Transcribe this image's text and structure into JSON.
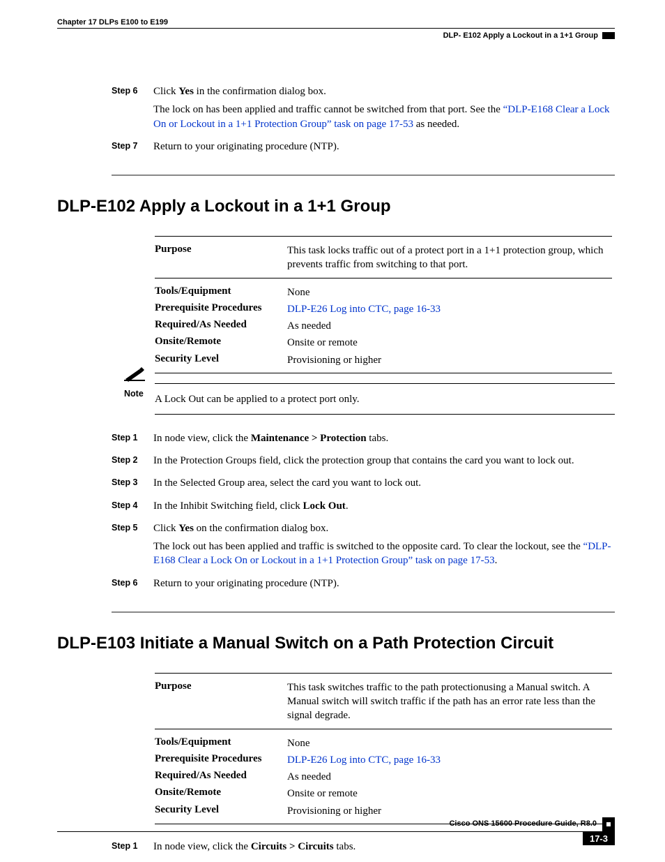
{
  "header": {
    "chapter": "Chapter 17 DLPs E100 to E199",
    "titlebar": "DLP- E102 Apply a Lockout in a 1+1 Group"
  },
  "topsteps": {
    "s6": {
      "label": "Step 6",
      "p1a": "Click ",
      "p1b": "Yes",
      "p1c": " in the confirmation dialog box.",
      "p2a": "The lock on has been applied and traffic cannot be switched from that port. See the ",
      "p2link": "“DLP-E168 Clear a Lock On or Lockout in a 1+1 Protection Group” task on page 17-53",
      "p2b": " as needed."
    },
    "s7": {
      "label": "Step 7",
      "p1": "Return to your originating procedure (NTP)."
    }
  },
  "sectA": {
    "title": "DLP-E102 Apply a Lockout in a 1+1 Group",
    "meta": {
      "purpose_k": "Purpose",
      "purpose_v": "This task locks traffic out of a protect port in a 1+1 protection group, which prevents traffic from switching to that port.",
      "tools_k": "Tools/Equipment",
      "tools_v": "None",
      "prereq_k": "Prerequisite Procedures",
      "prereq_v": "DLP-E26 Log into CTC, page 16-33",
      "req_k": "Required/As Needed",
      "req_v": "As needed",
      "onsite_k": "Onsite/Remote",
      "onsite_v": "Onsite or remote",
      "sec_k": "Security Level",
      "sec_v": "Provisioning or higher"
    },
    "note": {
      "label": "Note",
      "text": "A Lock Out can be applied to a protect port only."
    },
    "steps": {
      "s1": {
        "label": "Step 1",
        "a": "In node view, click the ",
        "b": "Maintenance > Protection",
        "c": " tabs."
      },
      "s2": {
        "label": "Step 2",
        "a": "In the Protection Groups field, click the protection group that contains the card you want to lock out."
      },
      "s3": {
        "label": "Step 3",
        "a": "In the Selected Group area, select the card you want to lock out."
      },
      "s4": {
        "label": "Step 4",
        "a": "In the Inhibit Switching field, click ",
        "b": "Lock Out",
        "c": "."
      },
      "s5": {
        "label": "Step 5",
        "a": "Click ",
        "b": "Yes",
        "c": " on the confirmation dialog box.",
        "p2a": "The lock out has been applied and traffic is switched to the opposite card. To clear the lockout, see the ",
        "p2link": "“DLP-E168 Clear a Lock On or Lockout in a 1+1 Protection Group” task on page 17-53",
        "p2b": "."
      },
      "s6": {
        "label": "Step 6",
        "a": "Return to your originating procedure (NTP)."
      }
    }
  },
  "sectB": {
    "title": "DLP-E103 Initiate a Manual Switch on a Path Protection Circuit",
    "meta": {
      "purpose_k": "Purpose",
      "purpose_v": "This task switches traffic to the path protectionusing a Manual switch. A Manual switch will switch traffic if the path has an error rate less than the signal degrade.",
      "tools_k": "Tools/Equipment",
      "tools_v": "None",
      "prereq_k": "Prerequisite Procedures",
      "prereq_v": "DLP-E26 Log into CTC, page 16-33",
      "req_k": "Required/As Needed",
      "req_v": "As needed",
      "onsite_k": "Onsite/Remote",
      "onsite_v": "Onsite or remote",
      "sec_k": "Security Level",
      "sec_v": "Provisioning or higher"
    },
    "steps": {
      "s1": {
        "label": "Step 1",
        "a": "In node view, click the ",
        "b": "Circuits > Circuits",
        "c": " tabs."
      }
    }
  },
  "footer": {
    "guide": "Cisco ONS 15600 Procedure Guide, R8.0",
    "page": "17-3"
  }
}
